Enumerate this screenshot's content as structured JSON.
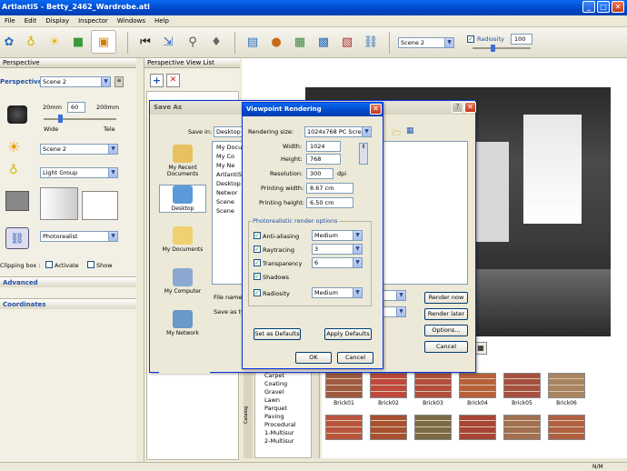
{
  "app": {
    "title": "ArtlantiS - Betty_2462_Wardrobe.atl",
    "controls": {
      "min": "_",
      "max": "□",
      "close": "✕"
    }
  },
  "menu": [
    "File",
    "Edit",
    "Display",
    "Inspector",
    "Windows",
    "Help"
  ],
  "toolbar": {
    "scene_select": "Scene 2",
    "radiosity_label": "Radiosity",
    "radiosity_value": "100"
  },
  "inspector": {
    "title": "Perspective",
    "section": "Perspective parameters",
    "scene": "Scene 2",
    "focal_min": "20mm",
    "focal_value": "60",
    "focal_max": "200mm",
    "wide": "Wide",
    "tele": "Tele",
    "sun": "Scene 2",
    "light": "Light Group",
    "render_type": "Photorealist",
    "clipping": "Clipping box :",
    "activate": "Activate",
    "show": "Show",
    "advanced": "Advanced",
    "coordinates": "Coordinates"
  },
  "perspective_list": {
    "title": "Perspective View List",
    "add": "+",
    "delete": "✕"
  },
  "save_as": {
    "title": "Save As",
    "save_in_label": "Save in:",
    "save_in": "Desktop",
    "places": [
      "My Recent Documents",
      "Desktop",
      "My Documents",
      "My Computer",
      "My Network"
    ],
    "files": [
      "My Docu",
      "My Co",
      "My Ne",
      "ArtlantiS",
      "Desktop",
      "Networ",
      "Scene",
      "Scene"
    ],
    "file_name_label": "File name:",
    "save_type_label": "Save as type:",
    "render_now": "Render now",
    "render_later": "Render later",
    "options": "Options...",
    "cancel": "Cancel"
  },
  "viewpoint": {
    "title": "Viewpoint Rendering",
    "size_label": "Rendering size:",
    "size": "1024x768 PC Screen",
    "width_label": "Width:",
    "width": "1024",
    "height_label": "Height:",
    "height": "768",
    "resolution_label": "Resolution:",
    "resolution": "300",
    "dpi": "dpi",
    "pwidth_label": "Printing width:",
    "pwidth": "8.67 cm",
    "pheight_label": "Printing height:",
    "pheight": "6.50 cm",
    "group": "Photorealistic render options",
    "options": [
      {
        "label": "Anti-aliasing",
        "value": "Medium"
      },
      {
        "label": "Raytracing",
        "value": "3"
      },
      {
        "label": "Transparency",
        "value": "6"
      },
      {
        "label": "Shadows",
        "value": ""
      },
      {
        "label": "Radiosity",
        "value": "Medium"
      }
    ],
    "set_defaults": "Set as Defaults",
    "apply_defaults": "Apply Defaults",
    "ok": "OK",
    "cancel": "Cancel"
  },
  "catalog": {
    "side_label": "Catalog",
    "tree": [
      "Carpet",
      "Coating",
      "Gravel",
      "Lawn",
      "Parquet",
      "Paving",
      "Procedural",
      "1-Multisur",
      "2-Multisur"
    ],
    "textures": [
      {
        "name": "Brick01",
        "color": "#a05a40"
      },
      {
        "name": "Brick02",
        "color": "#c0483c"
      },
      {
        "name": "Brick03",
        "color": "#b24e3c"
      },
      {
        "name": "Brick04",
        "color": "#b8603a"
      },
      {
        "name": "Brick05",
        "color": "#a85040"
      },
      {
        "name": "Brick06",
        "color": "#a88460"
      },
      {
        "name": "",
        "color": "#b8553c"
      },
      {
        "name": "",
        "color": "#a8502f"
      },
      {
        "name": "",
        "color": "#7a6a45"
      },
      {
        "name": "",
        "color": "#a84535"
      },
      {
        "name": "",
        "color": "#a07050"
      },
      {
        "name": "",
        "color": "#b06040"
      }
    ]
  },
  "status": {
    "units": "N/M"
  }
}
